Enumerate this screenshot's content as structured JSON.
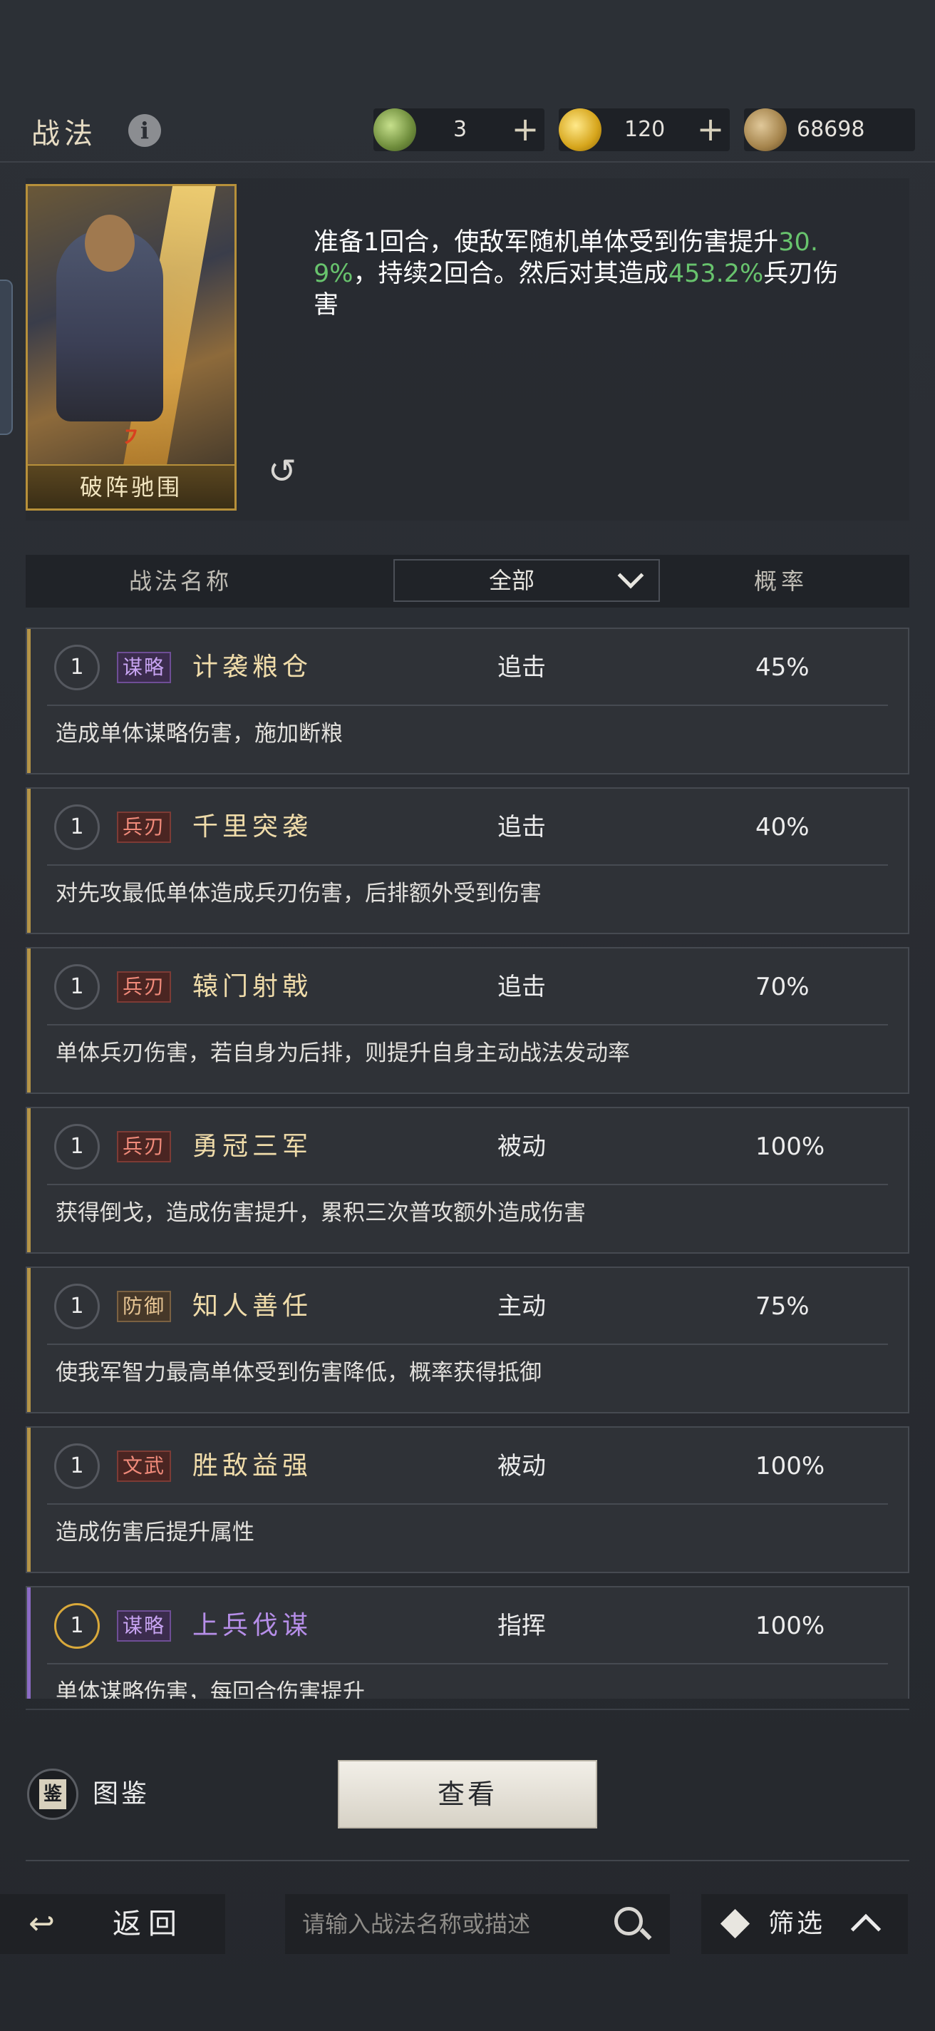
{
  "header": {
    "title": "战法",
    "resources": [
      {
        "icon": "jade-coin-icon",
        "value": "3"
      },
      {
        "icon": "gold-coin-icon",
        "value": "120"
      },
      {
        "icon": "copper-coin-icon",
        "value": "68698"
      }
    ],
    "plus_label": "+"
  },
  "hero": {
    "card_name": "破阵驰围",
    "rank_mark": "㇇",
    "description_parts": {
      "p1": "准备1回合，使敌军随机单体受到伤害提升",
      "v1": "30.9%",
      "p2": "，持续2回合。然后对其造成",
      "v2": "453.2%",
      "p3": "兵刃伤害"
    },
    "refresh_glyph": "↺"
  },
  "columns": {
    "name": "战法名称",
    "filter_value": "全部",
    "rate": "概率"
  },
  "tactics": [
    {
      "level": "1",
      "tag": "谋略",
      "name": "计袭粮仓",
      "type": "追击",
      "rate": "45%",
      "desc": "造成单体谋略伤害，施加断粮"
    },
    {
      "level": "1",
      "tag": "兵刃",
      "name": "千里突袭",
      "type": "追击",
      "rate": "40%",
      "desc": "对先攻最低单体造成兵刃伤害，后排额外受到伤害"
    },
    {
      "level": "1",
      "tag": "兵刃",
      "name": "辕门射戟",
      "type": "追击",
      "rate": "70%",
      "desc": "单体兵刃伤害，若自身为后排，则提升自身主动战法发动率"
    },
    {
      "level": "1",
      "tag": "兵刃",
      "name": "勇冠三军",
      "type": "被动",
      "rate": "100%",
      "desc": "获得倒戈，造成伤害提升，累积三次普攻额外造成伤害"
    },
    {
      "level": "1",
      "tag": "防御",
      "name": "知人善任",
      "type": "主动",
      "rate": "75%",
      "desc": "使我军智力最高单体受到伤害降低，概率获得抵御"
    },
    {
      "level": "1",
      "tag": "文武",
      "name": "胜敌益强",
      "type": "被动",
      "rate": "100%",
      "desc": "造成伤害后提升属性"
    },
    {
      "level": "1",
      "tag": "谋略",
      "name": "上兵伐谋",
      "type": "指挥",
      "rate": "100%",
      "desc": "单体谋略伤害，每回合伤害提升"
    }
  ],
  "bottom": {
    "codex_label": "图鉴",
    "codex_glyph": "鉴",
    "view_button": "查看",
    "back_label": "返回",
    "search_placeholder": "请输入战法名称或描述",
    "filter_label": "筛选"
  }
}
